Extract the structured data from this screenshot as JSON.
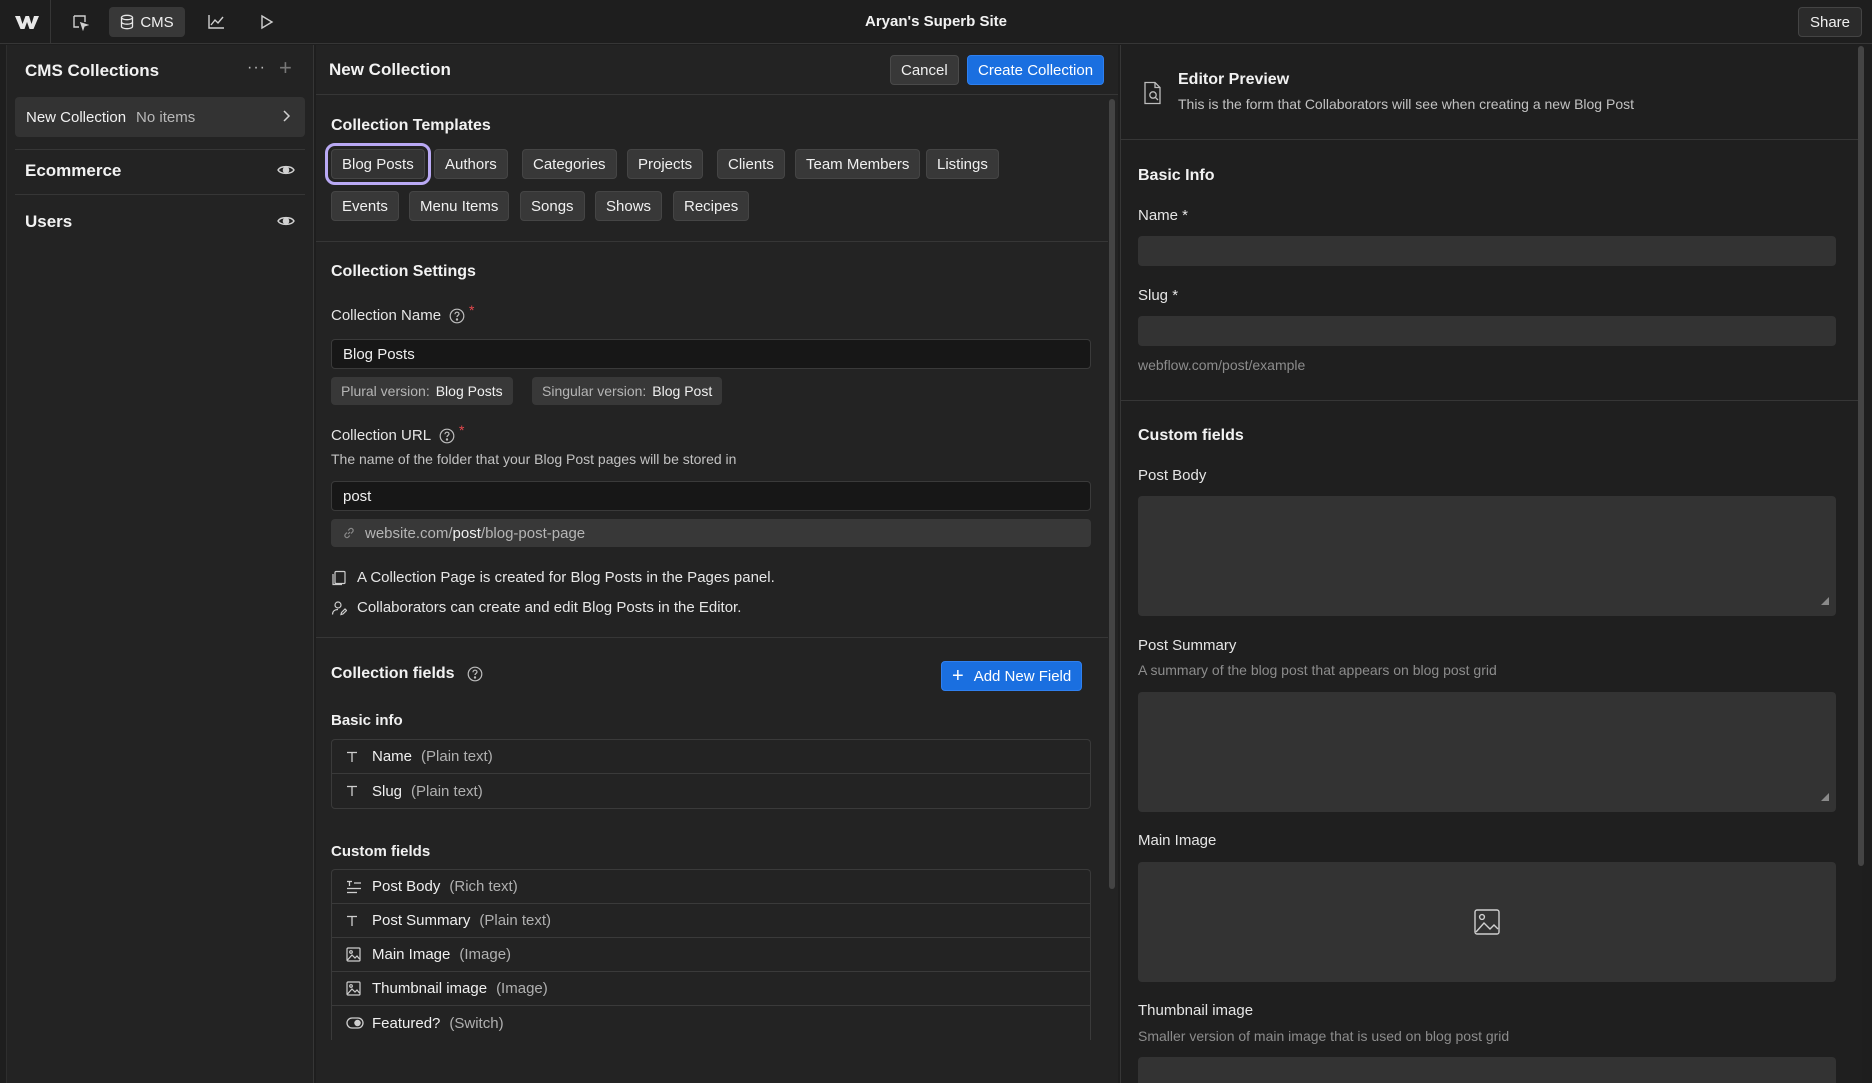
{
  "topbar": {
    "site_title": "Aryan's Superb Site",
    "cms_label": "CMS",
    "share_label": "Share"
  },
  "sidebar": {
    "title": "CMS Collections",
    "more_label": "···",
    "add_label": "+",
    "collection": {
      "name": "New Collection",
      "count": "No items"
    },
    "sections": [
      "Ecommerce",
      "Users"
    ]
  },
  "middle": {
    "title": "New Collection",
    "cancel_label": "Cancel",
    "create_label": "Create Collection",
    "templates": {
      "title": "Collection Templates",
      "items": [
        "Blog Posts",
        "Authors",
        "Categories",
        "Projects",
        "Clients",
        "Team Members",
        "Listings",
        "Events",
        "Menu Items",
        "Songs",
        "Shows",
        "Recipes"
      ],
      "selected": "Blog Posts"
    },
    "settings": {
      "title": "Collection Settings",
      "name_label": "Collection Name",
      "name_value": "Blog Posts",
      "required_mark": "*",
      "plural_key": "Plural version:",
      "plural_value": "Blog Posts",
      "singular_key": "Singular version:",
      "singular_value": "Blog Post",
      "url_label": "Collection URL",
      "url_desc": "The name of the folder that your Blog Post pages will be stored in",
      "url_value": "post",
      "url_preview_prefix": "website.com/",
      "url_preview_bold": "post",
      "url_preview_suffix": "/blog-post-page",
      "info_page": "A Collection Page is created for Blog Posts in the Pages panel.",
      "info_collab": "Collaborators can create and edit Blog Posts in the Editor."
    },
    "fields": {
      "title": "Collection fields",
      "add_label": "Add New Field",
      "basic_title": "Basic info",
      "basic": [
        {
          "icon": "text-icon",
          "name": "Name",
          "type": "(Plain text)"
        },
        {
          "icon": "text-icon",
          "name": "Slug",
          "type": "(Plain text)"
        }
      ],
      "custom_title": "Custom fields",
      "custom": [
        {
          "icon": "rich-text-icon",
          "name": "Post Body",
          "type": "(Rich text)"
        },
        {
          "icon": "text-icon",
          "name": "Post Summary",
          "type": "(Plain text)"
        },
        {
          "icon": "image-icon",
          "name": "Main Image",
          "type": "(Image)"
        },
        {
          "icon": "image-icon",
          "name": "Thumbnail image",
          "type": "(Image)"
        },
        {
          "icon": "switch-icon",
          "name": "Featured?",
          "type": "(Switch)"
        }
      ]
    }
  },
  "preview": {
    "title": "Editor Preview",
    "subtitle": "This is the form that Collaborators will see when creating a new Blog Post",
    "basic_title": "Basic Info",
    "name_label": "Name *",
    "slug_label": "Slug *",
    "slug_hint": "webflow.com/post/example",
    "custom_title": "Custom fields",
    "post_body_label": "Post Body",
    "post_summary_label": "Post Summary",
    "post_summary_hint": "A summary of the blog post that appears on blog post grid",
    "main_image_label": "Main Image",
    "thumbnail_label": "Thumbnail image",
    "thumbnail_hint": "Smaller version of main image that is used on blog post grid"
  },
  "colors": {
    "accent": "#1a6fe0",
    "selected_outline": "#b9a9f4",
    "required": "#e5484d",
    "background": "#1e1e1e"
  }
}
